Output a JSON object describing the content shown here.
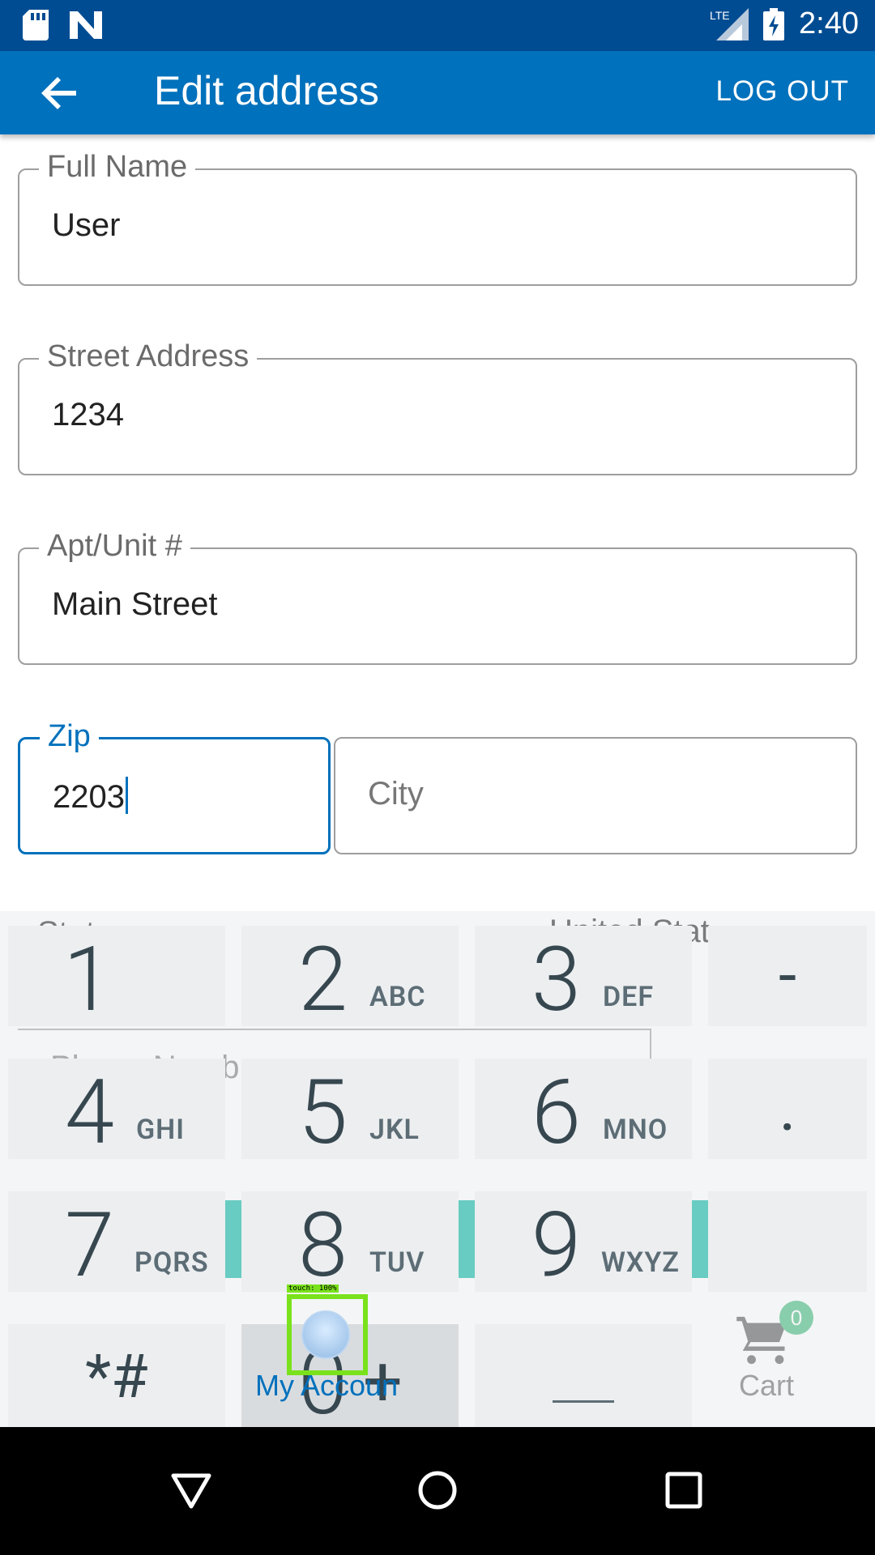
{
  "status_bar": {
    "time": "2:40",
    "network": "LTE",
    "icons": [
      "sd-card-icon",
      "n-logo-icon",
      "signal-icon",
      "battery-icon"
    ]
  },
  "app_bar": {
    "title": "Edit address",
    "logout_label": "LOG OUT",
    "back_icon": "arrow-back-icon"
  },
  "form": {
    "full_name": {
      "label": "Full Name",
      "value": "User"
    },
    "street": {
      "label": "Street Address",
      "value": "1234"
    },
    "apt": {
      "label": "Apt/Unit #",
      "value": "Main Street"
    },
    "zip": {
      "label": "Zip",
      "value": "2203"
    },
    "city": {
      "placeholder": "City"
    }
  },
  "partially_hidden": {
    "state_label": "State",
    "country_value": "United Stat",
    "phone_label": "Phone Numb"
  },
  "bottom_nav": {
    "account_label": "My Accoun",
    "cart_label": "Cart",
    "cart_count": "0"
  },
  "touch_overlay": {
    "label": "touch: 100%"
  },
  "keyboard": {
    "keys": [
      {
        "digit": "1",
        "letters": ""
      },
      {
        "digit": "2",
        "letters": "ABC"
      },
      {
        "digit": "3",
        "letters": "DEF"
      },
      {
        "sym": "-"
      },
      {
        "digit": "4",
        "letters": "GHI"
      },
      {
        "digit": "5",
        "letters": "JKL"
      },
      {
        "digit": "6",
        "letters": "MNO"
      },
      {
        "sym": "."
      },
      {
        "digit": "7",
        "letters": "PQRS"
      },
      {
        "digit": "8",
        "letters": "TUV"
      },
      {
        "digit": "9",
        "letters": "WXYZ"
      },
      {
        "sym": ""
      },
      {
        "sym": "*#"
      },
      {
        "digit": "0",
        "letters": "+"
      },
      {
        "sym": "space"
      },
      {
        "sym": ""
      }
    ]
  }
}
